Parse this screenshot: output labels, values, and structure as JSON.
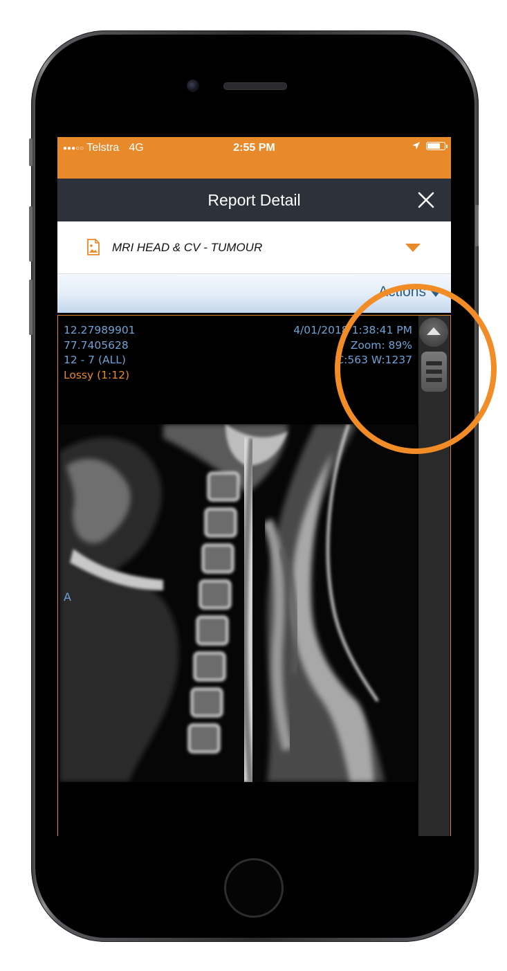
{
  "status_bar": {
    "carrier": "Telstra",
    "network": "4G",
    "time": "2:55 PM",
    "signal_bars": 3,
    "signal_max": 5,
    "battery_level": 0.8
  },
  "nav": {
    "title": "Report Detail",
    "close_icon": "close-icon"
  },
  "report": {
    "name": "MRI HEAD & CV - TUMOUR",
    "icon": "image-file-icon"
  },
  "actions": {
    "label": "Actions"
  },
  "viewer": {
    "left_lines": [
      "12.27989901",
      "77.7405628",
      "12 - 7 (ALL)"
    ],
    "compression": "Lossy (1:12)",
    "right_lines": [
      "4/01/2018 1:38:41 PM",
      "Zoom: 89%",
      "C:563 W:1237"
    ],
    "orientation": "A"
  },
  "colors": {
    "accent": "#e8892a",
    "nav": "#2d3139",
    "overlay_text": "#6fa2d4",
    "actions_text": "#2a5e8a"
  }
}
